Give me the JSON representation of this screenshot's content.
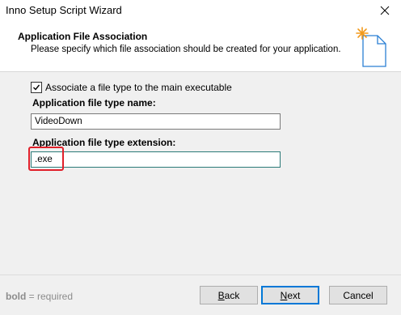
{
  "window": {
    "title": "Inno Setup Script Wizard"
  },
  "header": {
    "title": "Application File Association",
    "subtitle": "Please specify which file association should be created for your application."
  },
  "form": {
    "associate_checkbox": {
      "label": "Associate a file type to the main executable",
      "checked": true
    },
    "type_name": {
      "label": "Application file type name:",
      "value": "VideoDown"
    },
    "type_extension": {
      "label": "Application file type extension:",
      "value": ".exe"
    }
  },
  "footer": {
    "note_bold": "bold",
    "note_rest": " = required"
  },
  "buttons": {
    "back": "Back",
    "next": "Next",
    "cancel": "Cancel"
  },
  "colors": {
    "highlight": "#e0202a",
    "focus_border": "#2b7a78",
    "accent": "#0078d7"
  }
}
